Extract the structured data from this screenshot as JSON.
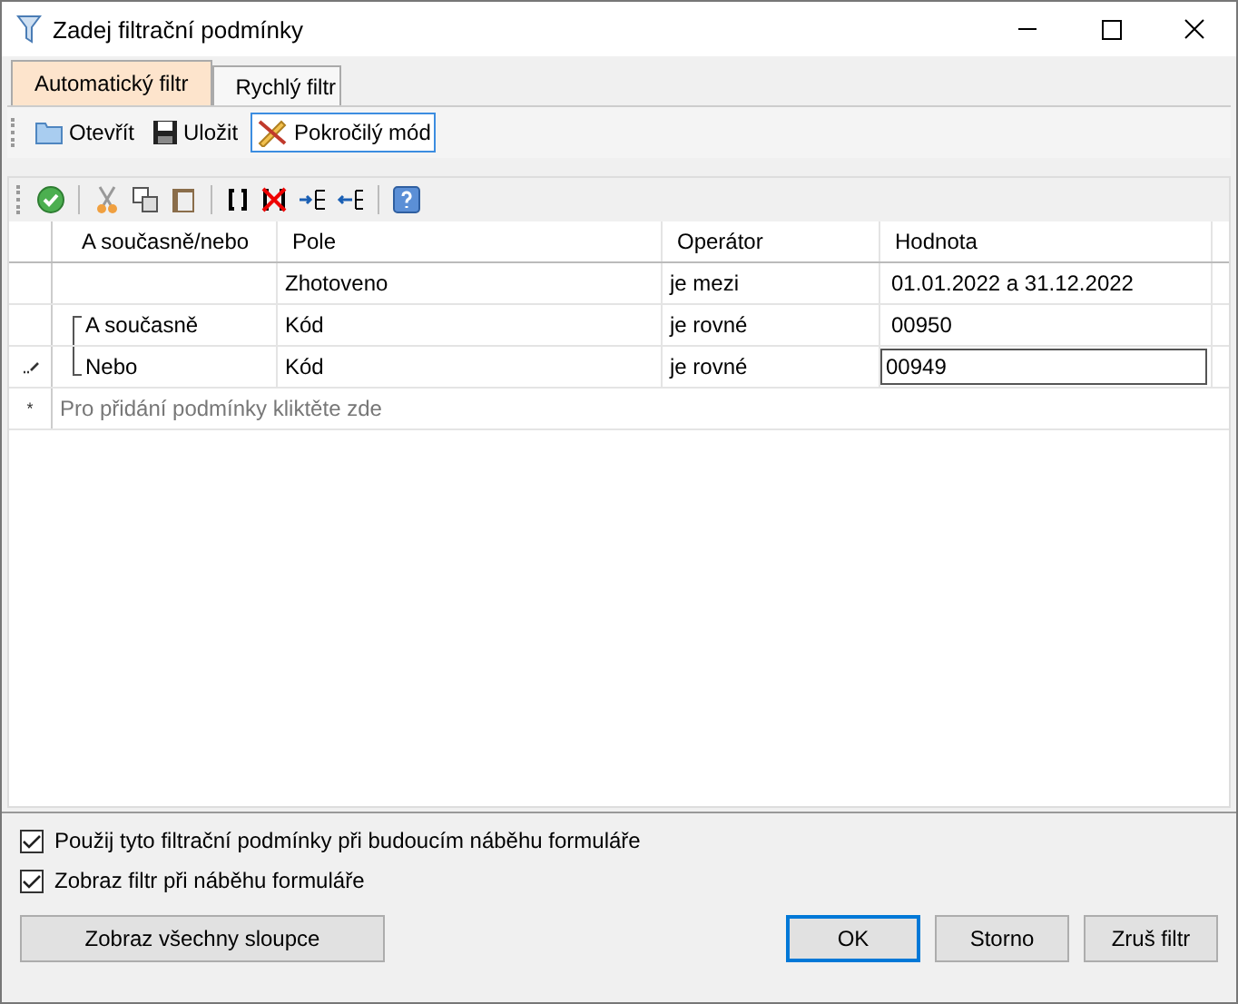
{
  "window": {
    "title": "Zadej filtrační podmínky"
  },
  "tabs": [
    {
      "label": "Automatický filtr",
      "selected": true
    },
    {
      "label": "Rychlý filtr",
      "selected": false
    }
  ],
  "toolbar": [
    {
      "kind": "open",
      "label": "Otevřít",
      "selected": false
    },
    {
      "kind": "save",
      "label": "Uložit",
      "selected": false
    },
    {
      "kind": "advanced",
      "label": "Pokročilý mód",
      "selected": true
    }
  ],
  "table": {
    "columns": [
      "A současně/nebo",
      "Pole",
      "Operátor",
      "Hodnota"
    ],
    "rows": [
      {
        "kind": "root",
        "field": "Zhotoveno",
        "operator": "je mezi",
        "value": "01.01.2022 a 31.12.2022",
        "editing": false
      },
      {
        "kind": "group_first",
        "logic": "A současně",
        "field": "Kód",
        "operator": "je rovné",
        "value": "00950",
        "editing": false
      },
      {
        "kind": "group_last",
        "logic": "Nebo",
        "field": "Kód",
        "operator": "je rovné",
        "value": "00949",
        "editing": true
      }
    ],
    "new_row": {
      "marker": "*",
      "placeholder": "Pro přidání podmínky kliktěte zde"
    }
  },
  "options": [
    {
      "label": "Použij tyto filtrační podmínky při budoucím náběhu formuláře",
      "checked": true
    },
    {
      "label": "Zobraz filtr při náběhu formuláře",
      "checked": true
    }
  ],
  "buttons": [
    {
      "kind": "left",
      "label": "Zobraz všechny sloupce",
      "default": false
    },
    {
      "kind": "right",
      "label": "OK",
      "default": true
    },
    {
      "kind": "right",
      "label": "Storno",
      "default": false
    },
    {
      "kind": "right",
      "label": "Zruš filtr",
      "default": false
    }
  ]
}
